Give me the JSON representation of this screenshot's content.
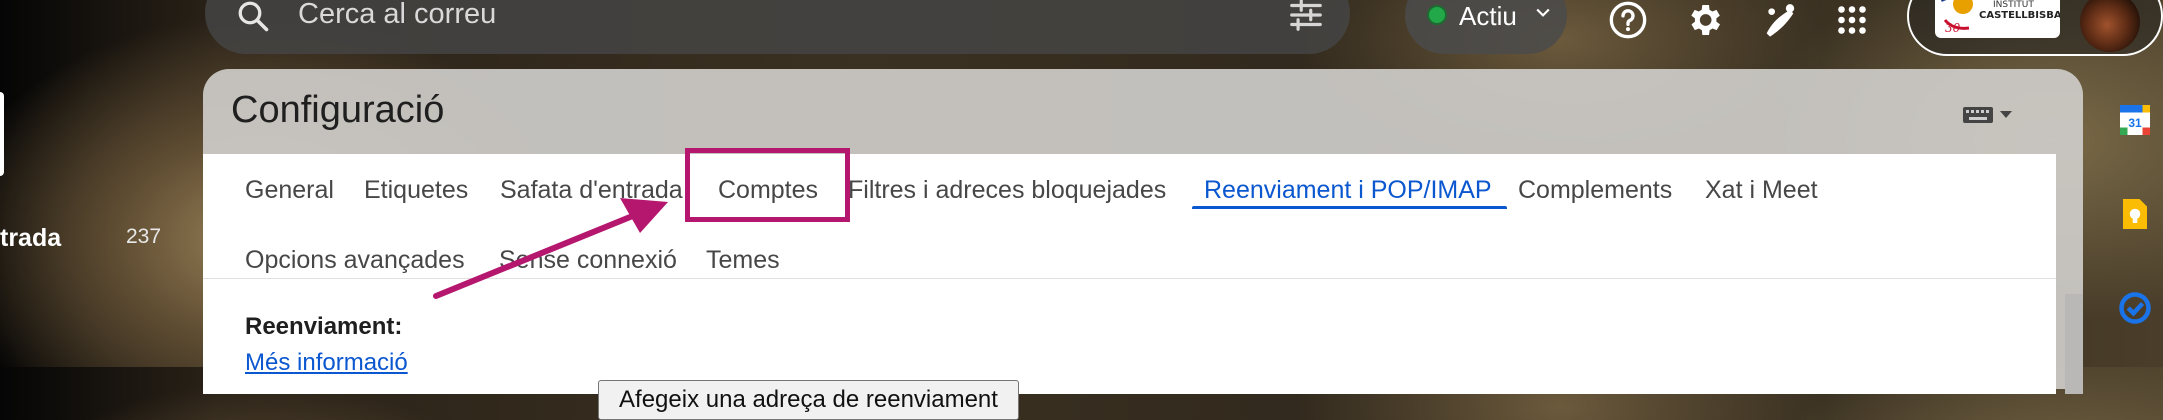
{
  "search": {
    "placeholder": "Cerca al correu"
  },
  "status": {
    "label": "Actiu",
    "color": "#22a849"
  },
  "account": {
    "logo_line1": "INSTITUT",
    "logo_line2": "CASTELLBISBAL"
  },
  "sidebar": {
    "inbox_label": "trada",
    "inbox_count": "237"
  },
  "settings": {
    "title": "Configuració",
    "tabs": [
      {
        "label": "General"
      },
      {
        "label": "Etiquetes"
      },
      {
        "label": "Safata d'entrada"
      },
      {
        "label": "Comptes"
      },
      {
        "label": "Filtres i adreces bloquejades"
      },
      {
        "label": "Reenviament i POP/IMAP",
        "active": true
      },
      {
        "label": "Complements"
      },
      {
        "label": "Xat i Meet"
      },
      {
        "label": "Opcions avançades"
      },
      {
        "label": "Sense connexió"
      },
      {
        "label": "Temes"
      }
    ],
    "forwarding_label": "Reenviament:",
    "more_info": "Més informació",
    "add_forward_button": "Afegeix una adreça de reenviament"
  },
  "annotation": {
    "color": "#b5176e"
  },
  "colors": {
    "accent": "#0b57d0",
    "tab_text": "#474747"
  },
  "right_rail": [
    "calendar-icon",
    "keep-icon",
    "tasks-icon"
  ]
}
